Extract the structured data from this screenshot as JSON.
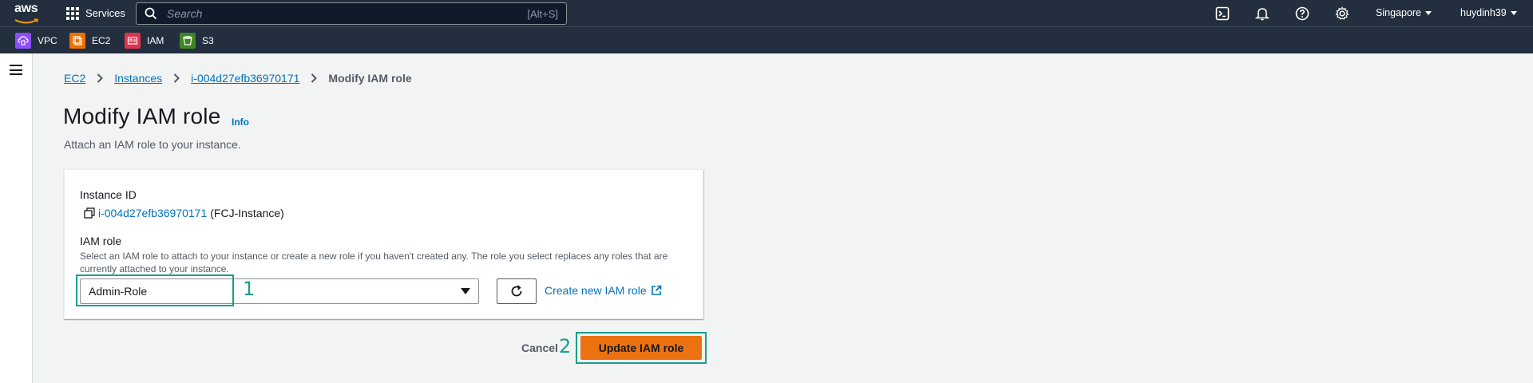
{
  "topnav": {
    "logo_text": "aws",
    "services_label": "Services",
    "search_placeholder": "Search",
    "search_shortcut": "[Alt+S]",
    "region": "Singapore",
    "user": "huydinh39"
  },
  "favorites": [
    {
      "label": "VPC",
      "icon": "vpc-icon",
      "color": "#8c4fff"
    },
    {
      "label": "EC2",
      "icon": "ec2-icon",
      "color": "#ed7100"
    },
    {
      "label": "IAM",
      "icon": "iam-icon",
      "color": "#dd344c"
    },
    {
      "label": "S3",
      "icon": "s3-icon",
      "color": "#3f8624"
    }
  ],
  "breadcrumb": {
    "items": [
      "EC2",
      "Instances",
      "i-004d27efb36970171"
    ],
    "current": "Modify IAM role"
  },
  "page": {
    "title": "Modify IAM role",
    "info": "Info",
    "subtitle": "Attach an IAM role to your instance."
  },
  "form": {
    "instance_id_label": "Instance ID",
    "instance_id": "i-004d27efb36970171",
    "instance_name": "(FCJ-Instance)",
    "iam_role_label": "IAM role",
    "iam_role_desc": "Select an IAM role to attach to your instance or create a new role if you haven't created any. The role you select replaces any roles that are currently attached to your instance.",
    "iam_role_value": "Admin-Role",
    "create_role_link": "Create new IAM role"
  },
  "actions": {
    "cancel": "Cancel",
    "update": "Update IAM role"
  },
  "annotations": [
    "1",
    "2"
  ],
  "colors": {
    "nav_bg": "#232f3e",
    "link": "#0073bb",
    "primary_button": "#ec7211",
    "annotation": "#16a08b"
  }
}
